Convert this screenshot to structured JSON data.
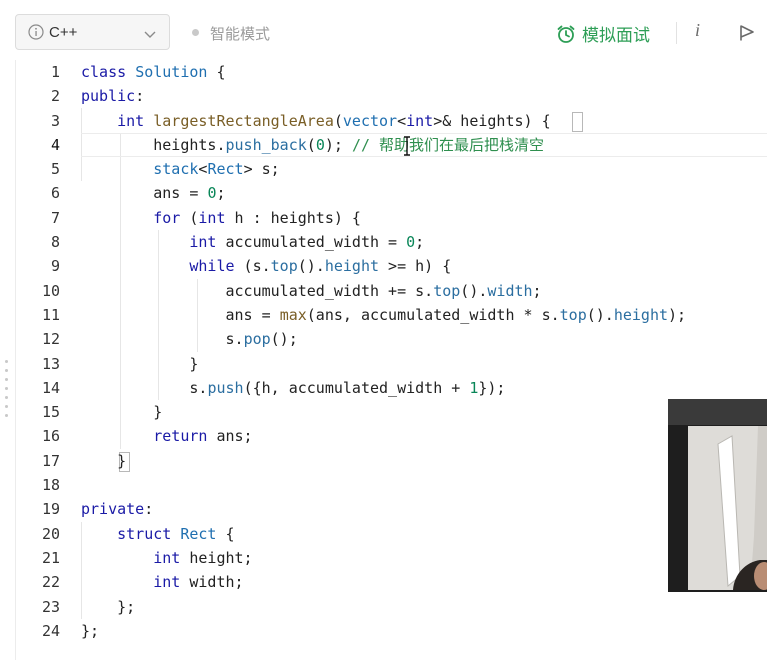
{
  "toolbar": {
    "language": "C++",
    "mode_label": "智能模式",
    "mock_interview_label": "模拟面试",
    "info_button": "i"
  },
  "colors": {
    "accent_green": "#2d9e56",
    "keyword": "#1a1aa6",
    "type": "#1f6fb0",
    "function": "#795e26",
    "number": "#098658",
    "comment": "#2f8f4f"
  },
  "editor": {
    "current_line": 4,
    "line_numbers": [
      "1",
      "2",
      "3",
      "4",
      "5",
      "6",
      "7",
      "8",
      "9",
      "10",
      "11",
      "12",
      "13",
      "14",
      "15",
      "16",
      "17",
      "18",
      "19",
      "20",
      "21",
      "22",
      "23",
      "24"
    ],
    "lines": [
      "class Solution {",
      "public:",
      "    int largestRectangleArea(vector<int>& heights) {",
      "        heights.push_back(0); // 帮助我们在最后把栈清空",
      "        stack<Rect> s;",
      "        ans = 0;",
      "        for (int h : heights) {",
      "            int accumulated_width = 0;",
      "            while (s.top().height >= h) {",
      "                accumulated_width += s.top().width;",
      "                ans = max(ans, accumulated_width * s.top().height);",
      "                s.pop();",
      "            }",
      "            s.push({h, accumulated_width + 1});",
      "        }",
      "        return ans;",
      "    }",
      "",
      "private:",
      "    struct Rect {",
      "        int height;",
      "        int width;",
      "    };",
      "};"
    ]
  }
}
